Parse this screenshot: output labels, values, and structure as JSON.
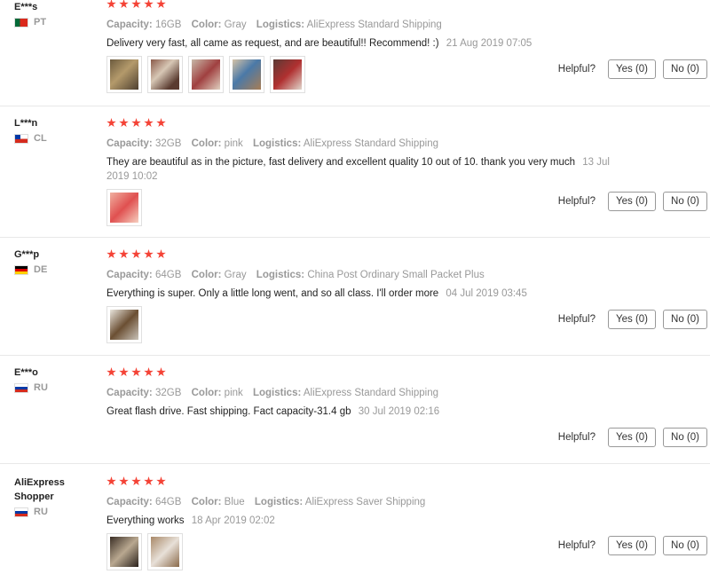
{
  "labels": {
    "capacity": "Capacity:",
    "color": "Color:",
    "logistics": "Logistics:",
    "helpful": "Helpful?"
  },
  "reviews": [
    {
      "user": "E***s",
      "country": "PT",
      "rating": 5,
      "capacity": "16GB",
      "color": "Gray",
      "logistics": "AliExpress Standard Shipping",
      "text": "Delivery very fast, all came as request, and are beautiful!! Recommend! :)",
      "date": "21 Aug 2019 07:05",
      "photo_count": 5,
      "yes": "Yes (0)",
      "no": "No (0)"
    },
    {
      "user": "L***n",
      "country": "CL",
      "rating": 5,
      "capacity": "32GB",
      "color": "pink",
      "logistics": "AliExpress Standard Shipping",
      "text": "They are beautiful as in the picture, fast delivery and excellent quality 10 out of 10. thank you very much",
      "date": "13 Jul 2019 10:02",
      "photo_count": 1,
      "yes": "Yes (0)",
      "no": "No (0)"
    },
    {
      "user": "G***p",
      "country": "DE",
      "rating": 5,
      "capacity": "64GB",
      "color": "Gray",
      "logistics": "China Post Ordinary Small Packet Plus",
      "text": "Everything is super. Only a little long went, and so all class. I'll order more",
      "date": "04 Jul 2019 03:45",
      "photo_count": 1,
      "yes": "Yes (0)",
      "no": "No (0)"
    },
    {
      "user": "E***o",
      "country": "RU",
      "rating": 5,
      "capacity": "32GB",
      "color": "pink",
      "logistics": "AliExpress Standard Shipping",
      "text": "Great flash drive. Fast shipping. Fact capacity-31.4 gb",
      "date": "30 Jul 2019 02:16",
      "photo_count": 0,
      "yes": "Yes (0)",
      "no": "No (0)"
    },
    {
      "user": "AliExpress Shopper",
      "country": "RU",
      "rating": 5,
      "capacity": "64GB",
      "color": "Blue",
      "logistics": "AliExpress Saver Shipping",
      "text": "Everything works",
      "date": "18 Apr 2019 02:02",
      "photo_count": 2,
      "yes": "Yes (0)",
      "no": "No (0)"
    }
  ]
}
